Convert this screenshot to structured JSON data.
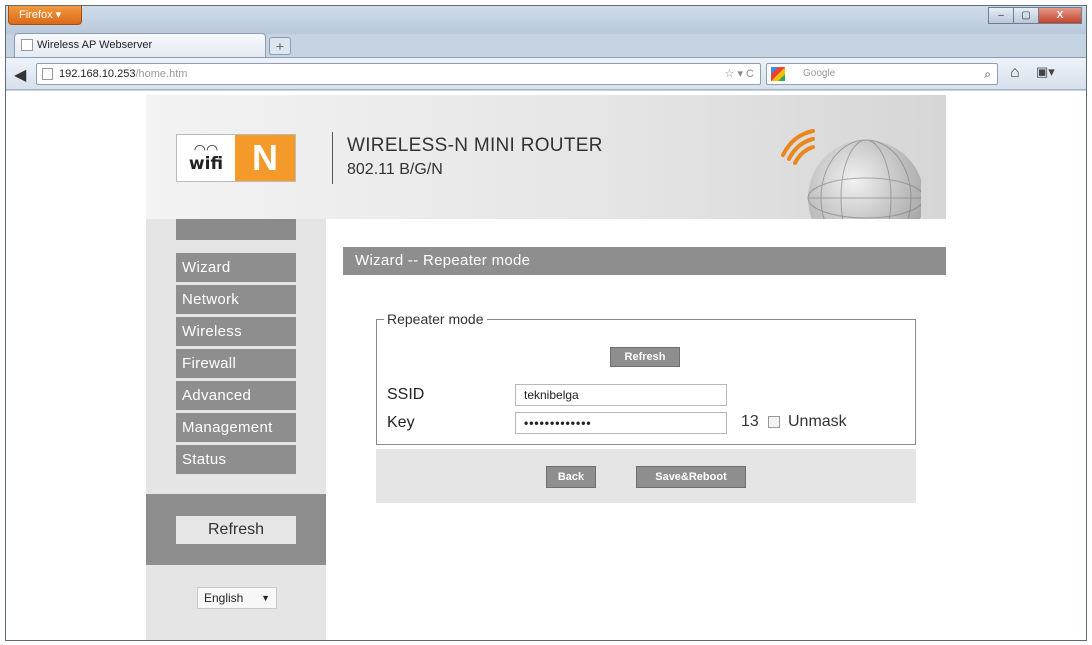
{
  "browser": {
    "menu_label": "Firefox ▾",
    "tab_title": "Wireless AP Webserver",
    "new_tab": "+",
    "url_host": "192.168.10.253",
    "url_path": "/home.htm",
    "url_right_icons": "☆ ▾ C",
    "search_placeholder": "Google",
    "window_controls": [
      "–",
      "▢",
      "X"
    ]
  },
  "header": {
    "logo_word": "wifi",
    "logo_letter": "N",
    "title": "WIRELESS-N MINI ROUTER",
    "subtitle": "802.11 B/G/N"
  },
  "sidebar": {
    "items": [
      {
        "label": "Wizard"
      },
      {
        "label": "Network"
      },
      {
        "label": "Wireless"
      },
      {
        "label": "Firewall"
      },
      {
        "label": "Advanced"
      },
      {
        "label": "Management"
      },
      {
        "label": "Status"
      }
    ],
    "refresh_label": "Refresh",
    "language": "English"
  },
  "main": {
    "title": "Wizard -- Repeater mode",
    "fieldset_legend": "Repeater mode",
    "refresh_label": "Refresh",
    "ssid_label": "SSID",
    "ssid_value": "teknibelga",
    "key_label": "Key",
    "key_value": "•••••••••••••",
    "key_length": "13",
    "unmask_label": "Unmask",
    "back_label": "Back",
    "save_label": "Save&Reboot"
  },
  "colors": {
    "nav_gray": "#8e8e8e",
    "logo_orange": "#f39a2a",
    "panel_light": "#e5e5e5"
  }
}
